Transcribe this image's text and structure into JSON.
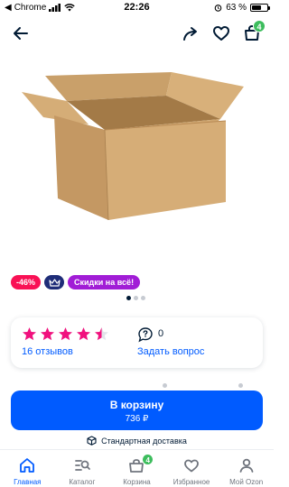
{
  "status_bar": {
    "carrier": "Chrome",
    "time": "22:26",
    "battery": "63 %",
    "battery_level": 0.63
  },
  "top_nav": {
    "cart_count": "4",
    "icons": [
      "arrow-left-icon",
      "share-icon",
      "heart-icon",
      "cart-icon"
    ]
  },
  "product": {
    "discount": "-46%",
    "promo": "Скидки на всё!",
    "gallery_count": 3,
    "gallery_active": 0
  },
  "rating": {
    "stars": 4.5,
    "reviews": "16 отзывов",
    "questions_count": "0",
    "ask_question": "Задать вопрос"
  },
  "buy": {
    "label": "В корзину",
    "price": "736 ₽",
    "delivery": "Стандартная доставка"
  },
  "tabbar": {
    "items": [
      {
        "label": "Главная",
        "icon": "home-icon",
        "active": true
      },
      {
        "label": "Каталог",
        "icon": "catalog-icon",
        "active": false
      },
      {
        "label": "Корзина",
        "icon": "cart-icon",
        "badge": "4",
        "active": false
      },
      {
        "label": "Избранное",
        "icon": "heart-icon",
        "active": false
      },
      {
        "label": "Мой Ozon",
        "icon": "profile-icon",
        "active": false
      }
    ]
  },
  "colors": {
    "accent": "#005bff",
    "badge_green": "#3dbd5d",
    "discount": "#f91155",
    "promo": "#a11dd6",
    "star": "#f1117e"
  }
}
